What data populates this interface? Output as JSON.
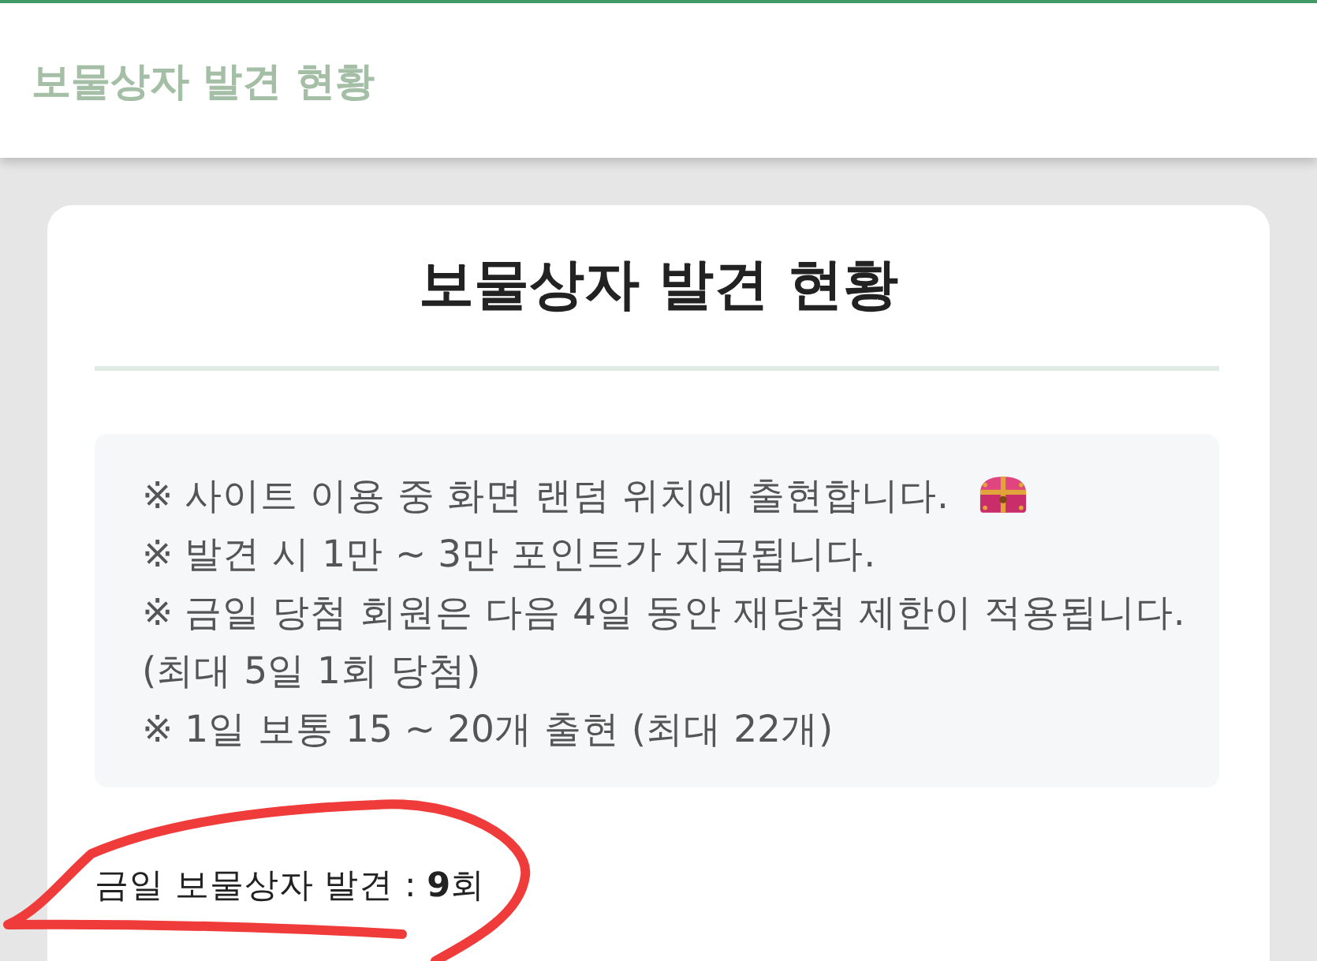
{
  "header": {
    "title": "보물상자 발견 현황"
  },
  "card": {
    "title": "보물상자 발견 현황",
    "notices": [
      {
        "text": "※ 사이트 이용 중 화면 랜덤 위치에 출현합니다.",
        "icon": true
      },
      {
        "text": "※ 발견 시 1만 ~ 3만 포인트가 지급됩니다.",
        "icon": false
      },
      {
        "text": "※ 금일 당첨 회원은 다음 4일 동안 재당첨 제한이 적용됩니다.",
        "icon": false
      },
      {
        "text": "(최대 5일 1회 당첨)",
        "icon": false
      },
      {
        "text": "※ 1일 보통 15 ~ 20개 출현 (최대 22개)",
        "icon": false
      }
    ],
    "count": "금일 보물상자 발견 : **9**회"
  },
  "annotation": {
    "kind": "freehand-circle"
  }
}
